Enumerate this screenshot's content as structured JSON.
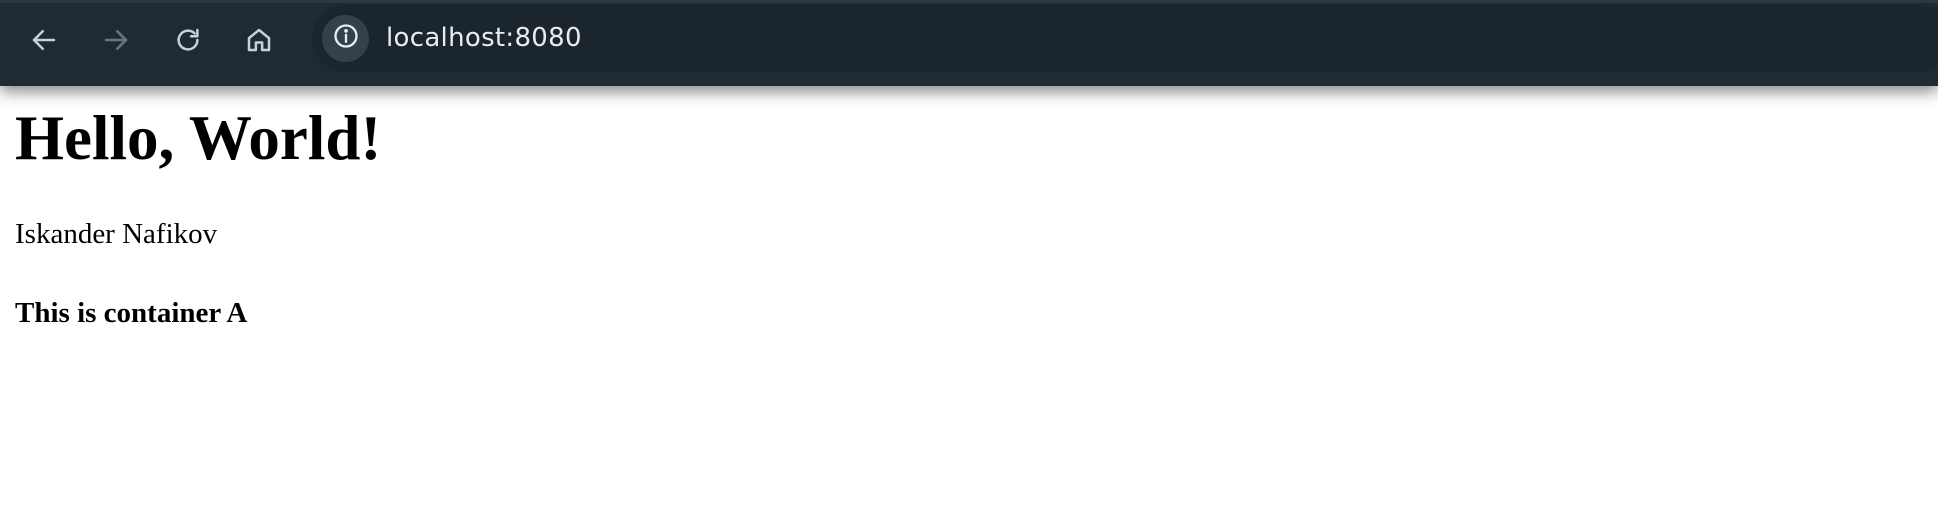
{
  "browser": {
    "url": "localhost:8080",
    "icons": {
      "back": "arrow-left-icon",
      "forward": "arrow-right-icon",
      "reload": "reload-icon",
      "home": "home-icon",
      "site_info": "info-icon"
    },
    "colors": {
      "toolbar": "#1f2a33",
      "address_bar": "#1b252d",
      "icon_active": "#c9d1d8",
      "icon_disabled": "#6b7780"
    }
  },
  "page": {
    "heading": "Hello, World!",
    "author": "Iskander Nafikov",
    "container_label": "This is container A"
  }
}
